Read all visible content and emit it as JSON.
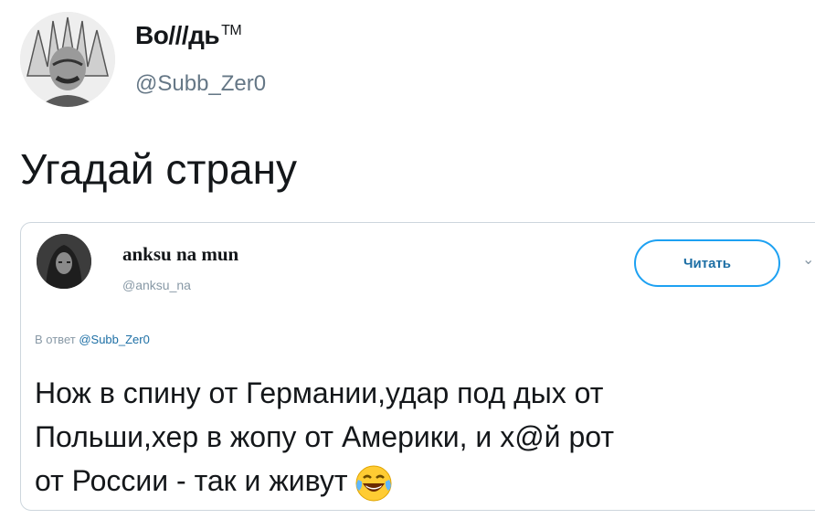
{
  "author": {
    "display_name": "Во///дь",
    "trademark": "TM",
    "handle": "@Subb_Zer0"
  },
  "tweet": {
    "text": "Угадай страну"
  },
  "quoted": {
    "display_name": "anksu na mun",
    "handle": "@anksu_na",
    "follow_label": "Читать",
    "reply_prefix": "В ответ",
    "reply_mention": "@Subb_Zer0",
    "lines": [
      "Нож в спину от Германии,удар под дых от",
      "Польши,хер в жопу от Америки, и х@й рот",
      "от России - так и живут"
    ],
    "emoji": "face-with-tears-of-joy-icon"
  },
  "colors": {
    "accent": "#1da1f2",
    "muted": "#657786",
    "border": "#cdd6dd"
  }
}
